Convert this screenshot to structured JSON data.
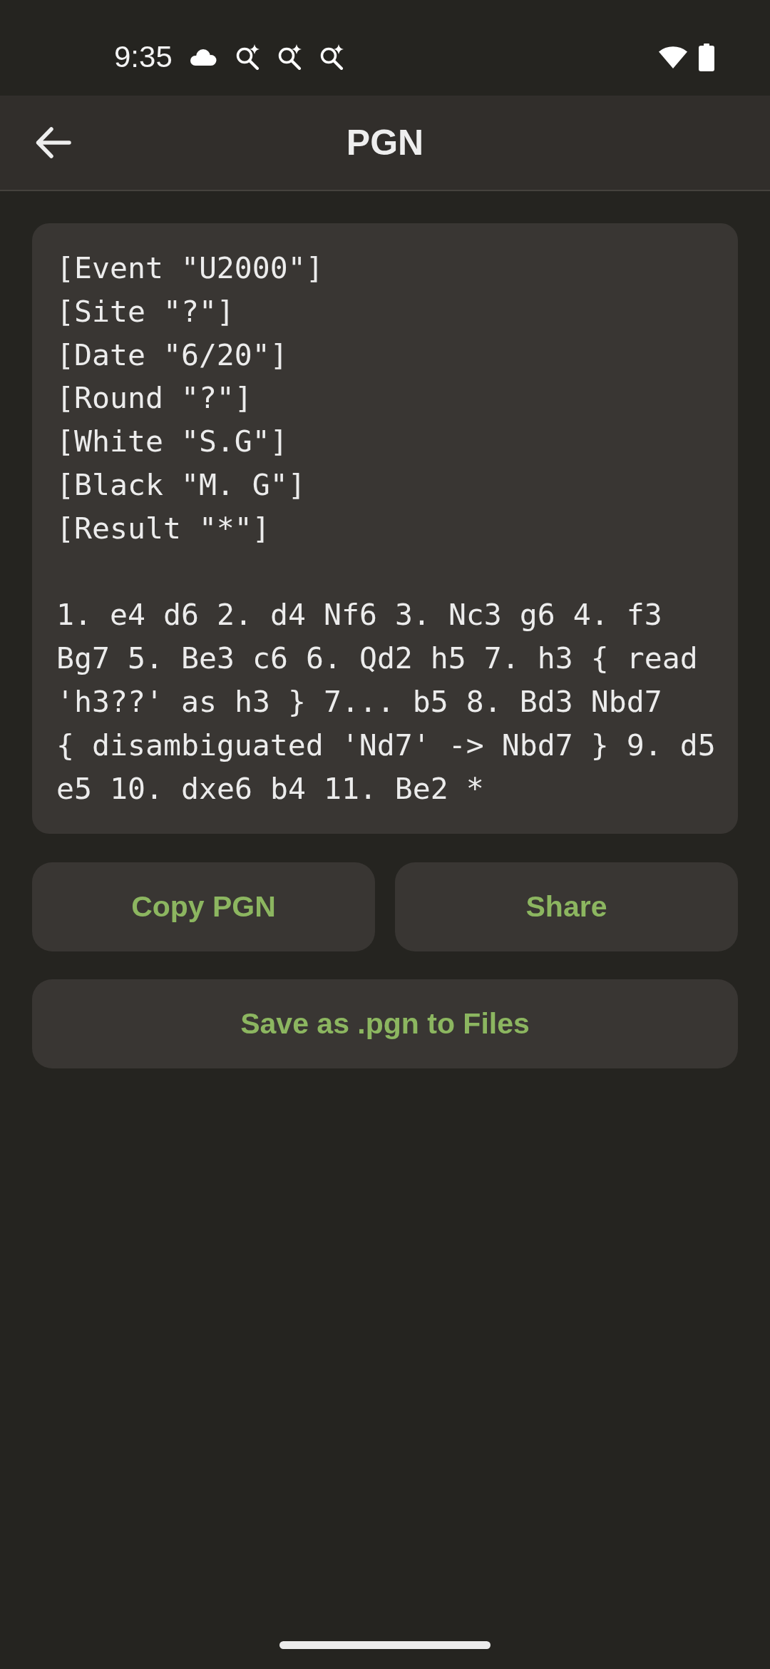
{
  "status_bar": {
    "time": "9:35"
  },
  "app_bar": {
    "title": "PGN"
  },
  "pgn": {
    "tags": [
      "[Event \"U2000\"]",
      "[Site \"?\"]",
      "[Date \"6/20\"]",
      "[Round \"?\"]",
      "[White \"S.G\"]",
      "[Black \"M. G\"]",
      "[Result \"*\"]"
    ],
    "movetext": "1. e4 d6 2. d4 Nf6 3. Nc3 g6 4. f3 Bg7 5. Be3 c6 6. Qd2 h5 7. h3 { read 'h3??' as h3 } 7... b5 8. Bd3 Nbd7 { disambiguated 'Nd7' -> Nbd7 } 9. d5 e5 10. dxe6 b4 11. Be2 *"
  },
  "actions": [
    {
      "label": "Copy PGN"
    },
    {
      "label": "Share"
    },
    {
      "label": "Save as .pgn to Files"
    }
  ]
}
